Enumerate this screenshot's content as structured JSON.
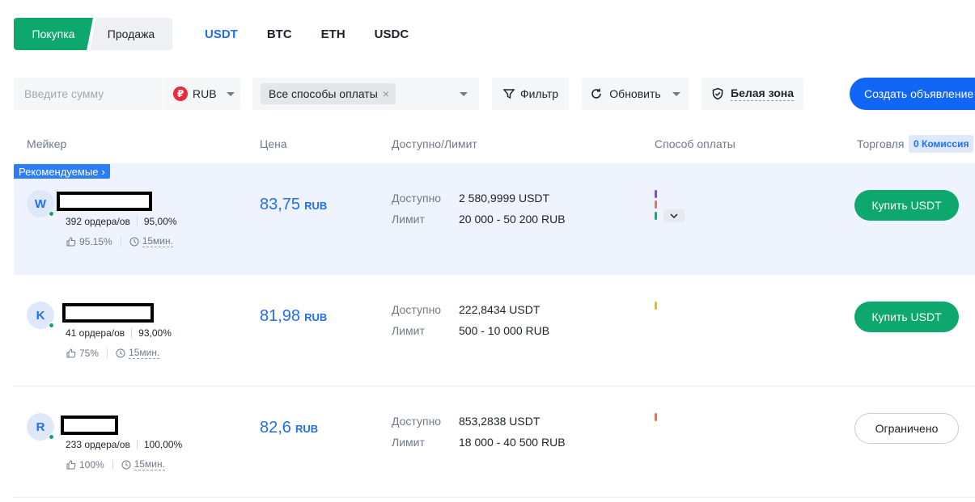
{
  "tabs": {
    "buy": "Покупка",
    "sell": "Продажа"
  },
  "coins": [
    "USDT",
    "BTC",
    "ETH",
    "USDC"
  ],
  "active_coin": "USDT",
  "filters": {
    "amount_placeholder": "Введите сумму",
    "currency": "RUB",
    "payment_chip": "Все способы оплаты",
    "filter_label": "Фильтр",
    "refresh_label": "Обновить",
    "white_zone_label": "Белая зона",
    "create_ad_label": "Создать объявление"
  },
  "table": {
    "headers": {
      "maker": "Мейкер",
      "price": "Цена",
      "available_limit": "Доступно/Лимит",
      "payment": "Способ оплаты",
      "trade": "Торговля",
      "commission_badge": "0 Комиссия"
    },
    "recommended_label": "Рекомендуемые",
    "available_label": "Доступно",
    "limit_label": "Лимит",
    "rows": [
      {
        "initial": "W",
        "orders": "392 ордера/ов",
        "completion": "95,00%",
        "rating": "95.15%",
        "time": "15мин.",
        "price": "83,75",
        "price_currency": "RUB",
        "available": "2 580,9999 USDT",
        "limit": "20 000 - 50 200 RUB",
        "payment_colors": [
          "#8a3ff0",
          "#f06a6a",
          "#0ea86f"
        ],
        "action": "Купить USDT"
      },
      {
        "initial": "K",
        "orders": "41 ордера/ов",
        "completion": "93,00%",
        "rating": "75%",
        "time": "15мин.",
        "price": "81,98",
        "price_currency": "RUB",
        "available": "222,8434 USDT",
        "limit": "500 - 10 000 RUB",
        "payment_colors": [
          "#f0b90b"
        ],
        "action": "Купить USDT"
      },
      {
        "initial": "R",
        "orders": "233 ордера/ов",
        "completion": "100,00%",
        "rating": "100%",
        "time": "15мин.",
        "price": "82,6",
        "price_currency": "RUB",
        "available": "853,2838 USDT",
        "limit": "18 000 - 40 500 RUB",
        "payment_colors": [
          "#f07040"
        ],
        "action": "Ограничено"
      }
    ]
  }
}
